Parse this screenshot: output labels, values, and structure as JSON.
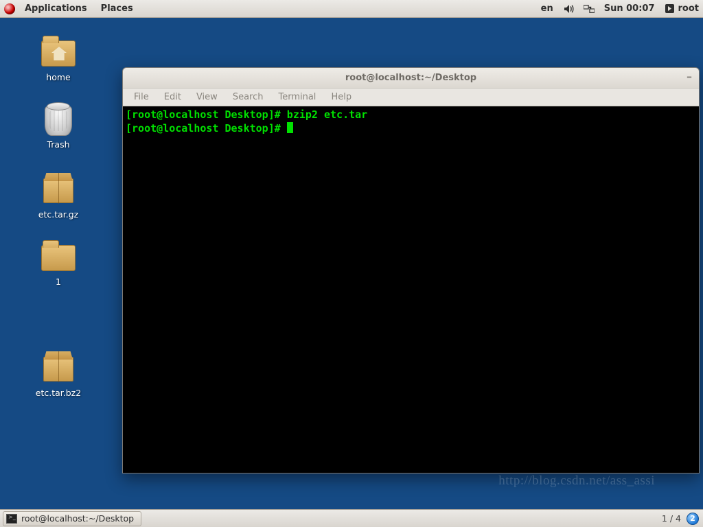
{
  "top": {
    "applications": "Applications",
    "places": "Places",
    "lang": "en",
    "clock": "Sun 00:07",
    "user": "root"
  },
  "desktop_icons": {
    "home": "home",
    "trash": "Trash",
    "etc_tar_gz": "etc.tar.gz",
    "folder1": "1",
    "etc_tar_bz2": "etc.tar.bz2"
  },
  "window": {
    "title": "root@localhost:~/Desktop",
    "menu": {
      "file": "File",
      "edit": "Edit",
      "view": "View",
      "search": "Search",
      "terminal": "Terminal",
      "help": "Help"
    }
  },
  "terminal": {
    "lines": [
      {
        "prompt": "[root@localhost Desktop]#",
        "cmd": " bzip2 etc.tar"
      },
      {
        "prompt": "[root@localhost Desktop]#",
        "cmd": " "
      }
    ]
  },
  "bottom": {
    "task": "root@localhost:~/Desktop",
    "workspace": "1 / 4",
    "badge": "2"
  },
  "watermark": "http://blog.csdn.net/ass_assi"
}
